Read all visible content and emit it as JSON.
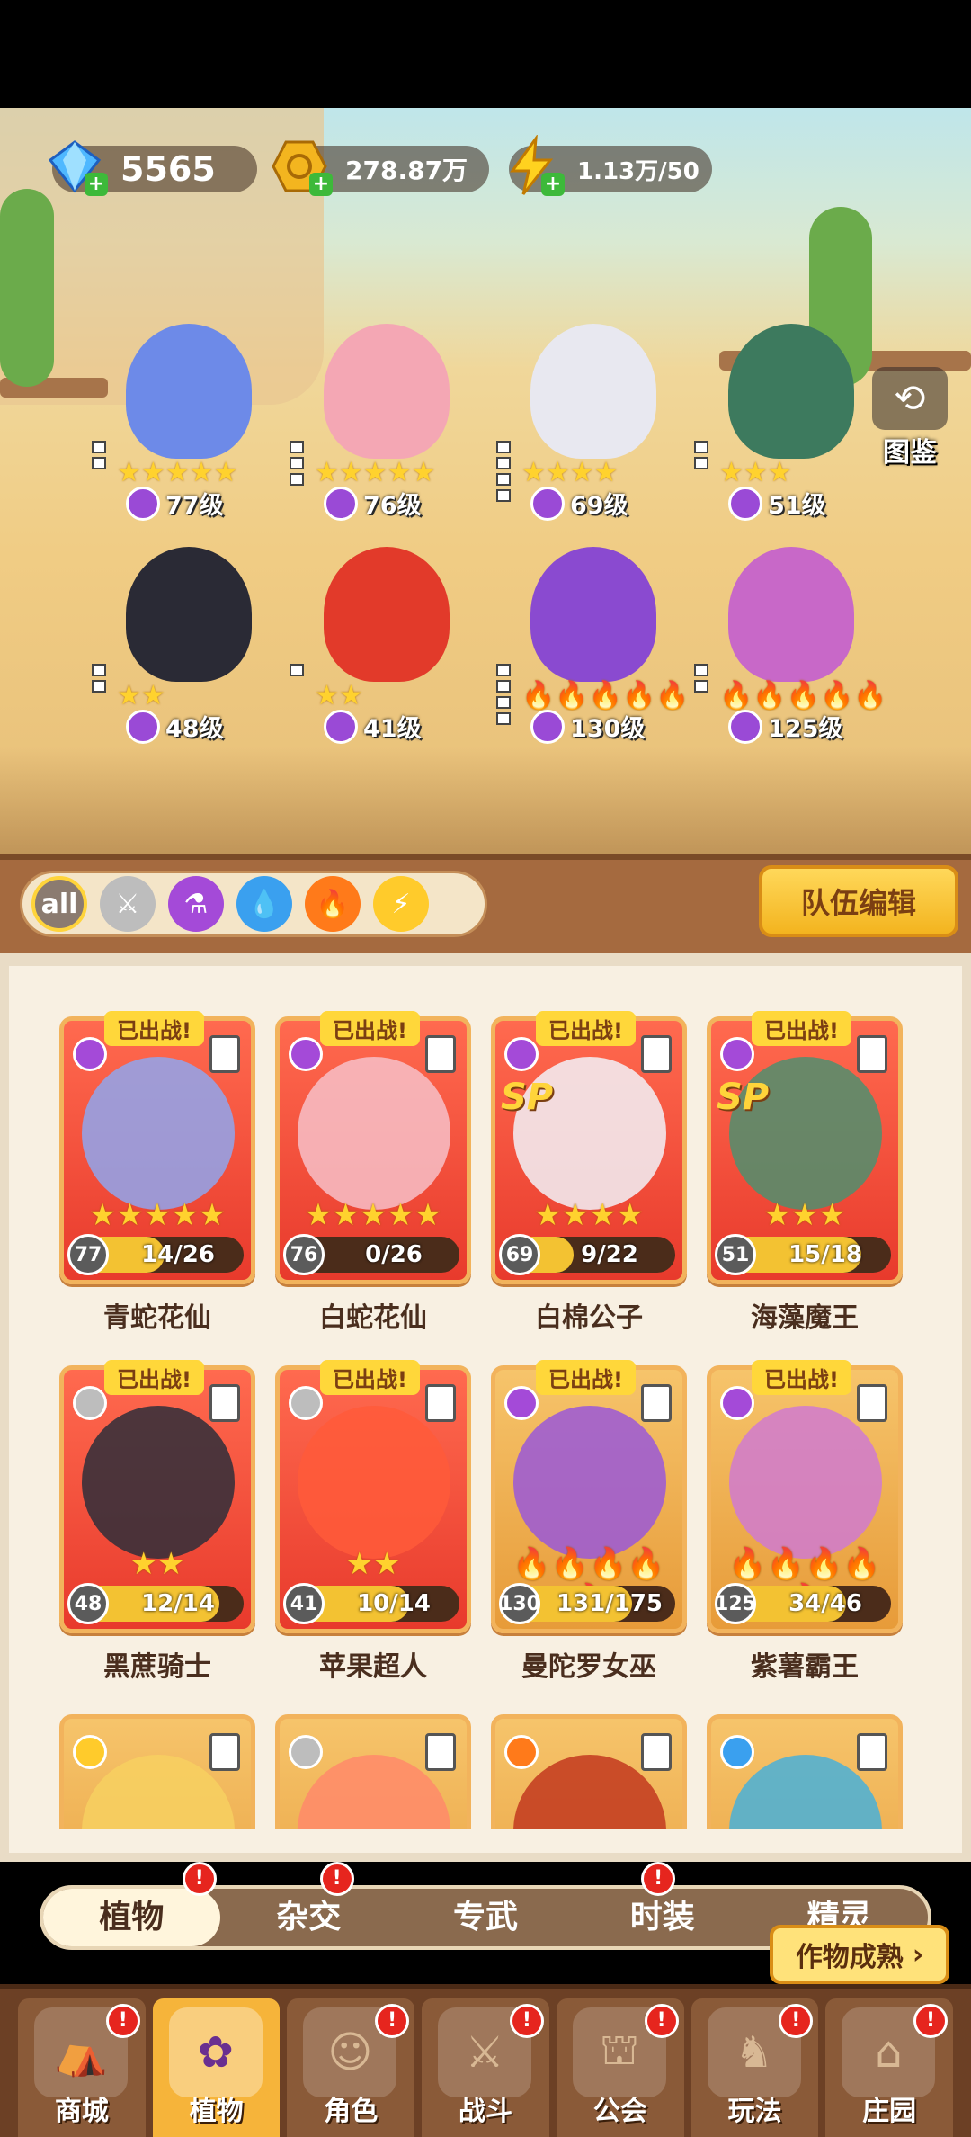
{
  "resources": [
    {
      "name": "diamond",
      "icon": "diamond-icon",
      "value": "5565"
    },
    {
      "name": "gold",
      "icon": "gold-coin-icon",
      "value": "278.87万"
    },
    {
      "name": "energy",
      "icon": "lightning-icon",
      "value": "1.13万/50"
    }
  ],
  "codex": {
    "label": "图鉴",
    "icon": "codex-icon"
  },
  "team_units": [
    {
      "level": "77级",
      "stars": "★★★★★",
      "slots": 2
    },
    {
      "level": "76级",
      "stars": "★★★★★",
      "slots": 3
    },
    {
      "level": "69级",
      "stars": "★★★★",
      "slots": 4
    },
    {
      "level": "51级",
      "stars": "★★★",
      "slots": 2
    },
    {
      "level": "48级",
      "stars": "★★",
      "slots": 2
    },
    {
      "level": "41级",
      "stars": "★★",
      "slots": 1
    },
    {
      "level": "130级",
      "stars": "🔥🔥🔥🔥🔥",
      "slots": 4
    },
    {
      "level": "125级",
      "stars": "🔥🔥🔥🔥🔥",
      "slots": 2
    }
  ],
  "filters": [
    {
      "label": "all",
      "icon": "all-icon"
    },
    {
      "label": "",
      "icon": "sword-icon"
    },
    {
      "label": "",
      "icon": "potion-icon"
    },
    {
      "label": "",
      "icon": "water-drop-icon"
    },
    {
      "label": "",
      "icon": "fire-icon"
    },
    {
      "label": "",
      "icon": "lightning-icon"
    }
  ],
  "team_edit_label": "队伍编辑",
  "deployed_label": "已出战!",
  "cards": [
    {
      "name": "青蛇花仙",
      "level": "77",
      "fragments": "14/26",
      "fill": 0.54,
      "stars": "★★★★★",
      "elem": "potion",
      "sp": "",
      "deployed": true,
      "color": "red"
    },
    {
      "name": "白蛇花仙",
      "level": "76",
      "fragments": "0/26",
      "fill": 0.0,
      "stars": "★★★★★",
      "elem": "potion",
      "sp": "",
      "deployed": true,
      "color": "red"
    },
    {
      "name": "白棉公子",
      "level": "69",
      "fragments": "9/22",
      "fill": 0.41,
      "stars": "★★★★",
      "elem": "potion",
      "sp": "SP",
      "deployed": true,
      "color": "red"
    },
    {
      "name": "海藻魔王",
      "level": "51",
      "fragments": "15/18",
      "fill": 0.83,
      "stars": "★★★",
      "elem": "potion",
      "sp": "SP",
      "deployed": true,
      "color": "red"
    },
    {
      "name": "黑蔗骑士",
      "level": "48",
      "fragments": "12/14",
      "fill": 0.86,
      "stars": "★★",
      "elem": "sword",
      "sp": "",
      "deployed": true,
      "color": "red"
    },
    {
      "name": "苹果超人",
      "level": "41",
      "fragments": "10/14",
      "fill": 0.71,
      "stars": "★★",
      "elem": "sword",
      "sp": "",
      "deployed": true,
      "color": "red"
    },
    {
      "name": "曼陀罗女巫",
      "level": "130",
      "fragments": "131/175",
      "fill": 0.75,
      "stars": "🔥🔥🔥🔥🔥",
      "elem": "potion",
      "sp": "",
      "deployed": true,
      "color": "gold"
    },
    {
      "name": "紫薯霸王",
      "level": "125",
      "fragments": "34/46",
      "fill": 0.74,
      "stars": "🔥🔥🔥🔥🔥",
      "elem": "potion",
      "sp": "",
      "deployed": true,
      "color": "gold"
    },
    {
      "name": "",
      "level": "",
      "fragments": "",
      "fill": 0,
      "stars": "",
      "elem": "bolt",
      "sp": "",
      "deployed": false,
      "color": "gold"
    },
    {
      "name": "",
      "level": "",
      "fragments": "",
      "fill": 0,
      "stars": "",
      "elem": "sword",
      "sp": "",
      "deployed": false,
      "color": "gold"
    },
    {
      "name": "",
      "level": "",
      "fragments": "",
      "fill": 0,
      "stars": "",
      "elem": "fire",
      "sp": "",
      "deployed": false,
      "color": "gold"
    },
    {
      "name": "",
      "level": "",
      "fragments": "",
      "fill": 0,
      "stars": "",
      "elem": "water",
      "sp": "",
      "deployed": false,
      "color": "gold"
    }
  ],
  "tabs": [
    {
      "label": "植物",
      "active": true,
      "alert": "!"
    },
    {
      "label": "杂交",
      "active": false,
      "alert": "!"
    },
    {
      "label": "专武",
      "active": false,
      "alert": ""
    },
    {
      "label": "时装",
      "active": false,
      "alert": "!"
    },
    {
      "label": "精灵",
      "active": false,
      "alert": ""
    }
  ],
  "crop_button": {
    "label": "作物成熟",
    "icon": "chevron-right-icon"
  },
  "nav": [
    {
      "label": "商城",
      "icon": "shop-icon",
      "active": false,
      "alert": "!"
    },
    {
      "label": "植物",
      "icon": "plant-icon",
      "active": true,
      "alert": ""
    },
    {
      "label": "角色",
      "icon": "character-icon",
      "active": false,
      "alert": "!"
    },
    {
      "label": "战斗",
      "icon": "battle-icon",
      "active": false,
      "alert": "!"
    },
    {
      "label": "公会",
      "icon": "guild-icon",
      "active": false,
      "alert": "!"
    },
    {
      "label": "玩法",
      "icon": "gameplay-icon",
      "active": false,
      "alert": "!"
    },
    {
      "label": "庄园",
      "icon": "manor-icon",
      "active": false,
      "alert": "!"
    }
  ],
  "colors": {
    "accent": "#ffd43a",
    "card_red": "#e83a2c",
    "card_gold": "#e79b39",
    "alert": "#e6251e",
    "nav_bg": "#6c4025"
  }
}
